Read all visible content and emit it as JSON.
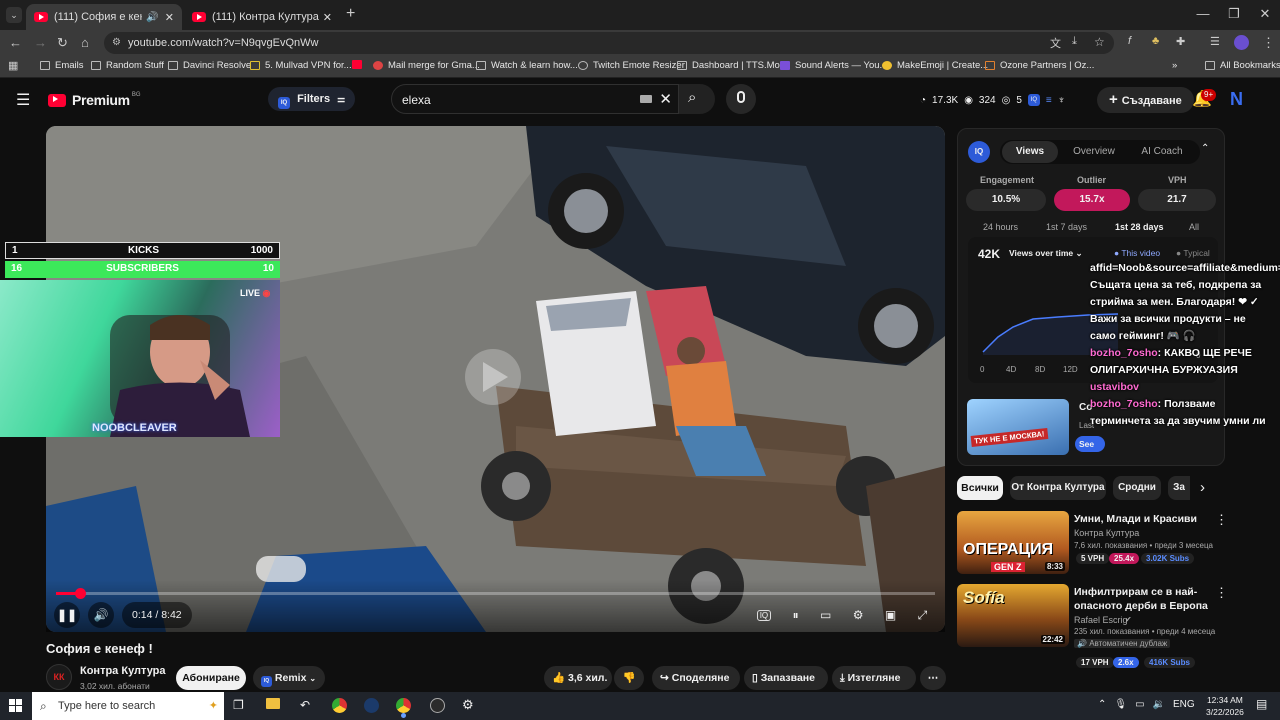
{
  "browser": {
    "tabs": [
      {
        "title": "(111) София е кенеф ! - Yo",
        "active": true
      },
      {
        "title": "(111) Контра Култура - YouTub",
        "active": false
      }
    ],
    "url": "youtube.com/watch?v=N9qvgEvQnWw",
    "bookmarks": [
      "Emails",
      "Random Stuff",
      "Davinci Resolve",
      "5. Mullvad VPN for...",
      "Mail merge for Gma...",
      "Watch & learn how...",
      "Twitch Emote Resizer",
      "Dashboard | TTS.Mo...",
      "Sound Alerts — You...",
      "MakeEmoji | Create...",
      "Ozone Partners | Oz..."
    ],
    "all_bookmarks": "All Bookmarks"
  },
  "youtube": {
    "logo": "Premium",
    "region": "BG",
    "filters": "Filters",
    "search_value": "elexa",
    "stats": {
      "views": "17.3K",
      "watching": "324",
      "count": "5"
    },
    "create_label": "Създаване",
    "notif_count": "9+",
    "avatar": "N"
  },
  "overlay": {
    "goal1": {
      "left": "1",
      "label": "KICKS",
      "right": "1000"
    },
    "goal2": {
      "left": "16",
      "label": "SUBSCRIBERS",
      "right": "10"
    },
    "live": "LIVE",
    "streamer": "NOOBCLEAVER"
  },
  "player": {
    "time": "0:14 / 8:42",
    "progress": 0.027
  },
  "video": {
    "title": "София е кенеф !",
    "channel": "Контра Култура",
    "subscribers": "3,02 хил. абонати",
    "subscribe": "Абониране",
    "remix": "Remix",
    "likes": "3,6 хил.",
    "share": "Споделяне",
    "save": "Запазване",
    "download": "Изтегляне"
  },
  "iq_panel": {
    "tabs": [
      "Views",
      "Overview",
      "AI Coach"
    ],
    "metric_labels": [
      "Engagement",
      "Outlier",
      "VPH"
    ],
    "metric_values": [
      "10.5%",
      "15.7x",
      "21.7"
    ],
    "ranges": [
      "24 hours",
      "1st 7 days",
      "1st 28 days",
      "All"
    ],
    "total": "42K",
    "mode": "Views over time",
    "legend": [
      "This video",
      "Typical"
    ],
    "x_ticks": [
      "0",
      "4D",
      "8D",
      "12D"
    ],
    "chart_zero": "0",
    "promo_title": "Co",
    "promo_thumb_text": "ТУК НЕ Е МОСКВА!",
    "promo_sub": "Last",
    "promo_btn": "See"
  },
  "chat": [
    {
      "user": "",
      "text": "affid=Noob&source=affiliate&medium=Noob Същата цена за теб, подкрепа за стрийма за мен. Благодаря! ❤ ✓ Важи за всички продукти – не само гейминг! 🎮 🎧"
    },
    {
      "user": "bozho_7osho",
      "text": ": КАКВО ЩЕ РЕЧЕ ОЛИГАРХИЧНА БУРЖУАЗИЯ"
    },
    {
      "user": "ustavibov",
      "text": ""
    },
    {
      "user": "bozho_7osho",
      "text": ": Ползваме терминчета за да звучим умни ли"
    }
  ],
  "filter_chips": [
    "Всички",
    "От Контра Култура",
    "Сродни",
    "За"
  ],
  "recommendations": [
    {
      "title": "Умни, Млади и Красиви",
      "channel": "Контра Култура",
      "meta": "7,6 хил. показвания • преди 3 месеца",
      "badges": [
        "5 VPH",
        "25.4x",
        "3.02K Subs"
      ],
      "duration": "8:33",
      "thumb_text": "ОПЕРАЦИЯ",
      "thumb_sub": "GEN Z"
    },
    {
      "title": "Инфилтрирам се в най-опасното дерби в Европа",
      "channel": "Rafael Escrig",
      "meta": "235 хил. показвания • преди 4 месеца",
      "extra": "Автоматичен дублаж",
      "badges": [
        "17 VPH",
        "2.6x",
        "416K Subs"
      ],
      "duration": "22:42",
      "thumb_text": "Sofía"
    }
  ],
  "taskbar": {
    "search_placeholder": "Type here to search",
    "lang": "ENG",
    "time": "12:34 AM",
    "date": "3/22/2026"
  }
}
